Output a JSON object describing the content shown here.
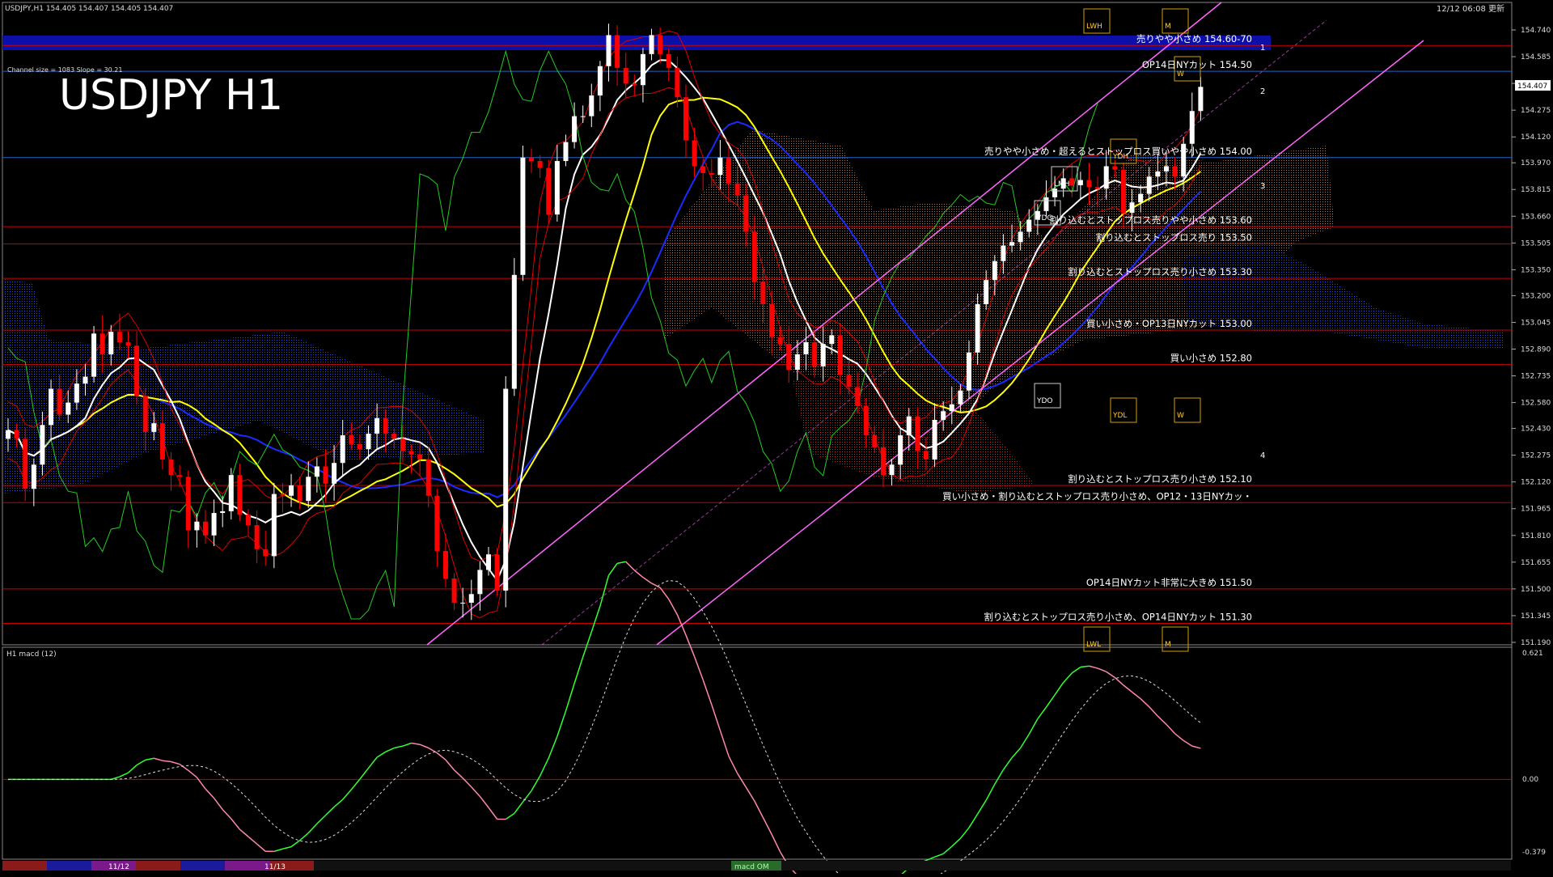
{
  "header": {
    "symbol_info": "USDJPY,H1  154.405 154.407 154.405 154.407",
    "big_title": "USDJPY H1",
    "channel_info": "Channel size = 1083 Slope = 30.21",
    "clock": "12/12 06:08 更新",
    "current_price": "154.407"
  },
  "sub_window": {
    "label": "H1  macd (12)",
    "scale": [
      "0.621",
      "0.00",
      "-0.379"
    ]
  },
  "bottom_bar": {
    "dates": [
      "11/12",
      "11/13"
    ],
    "indicator_label": "macd OM"
  },
  "colors": {
    "up_candle": "#ffffff",
    "down_candle": "#ff0000",
    "ma_white": "#ffffff",
    "ma_yellow": "#ffff00",
    "ma_blue": "#1a2bff",
    "channel": "#ff66ff",
    "macd_up": "#33ff33",
    "macd_down": "#ff88aa",
    "level_line": "#cc0000",
    "band_line": "#0000aa",
    "green_line": "#22cc22"
  },
  "chart_data": {
    "type": "candlestick",
    "title": "USDJPY H1",
    "ylim": [
      151.19,
      154.74
    ],
    "y_ticks": [
      "154.740",
      "154.585",
      "154.430",
      "154.275",
      "154.120",
      "153.970",
      "153.815",
      "153.660",
      "153.505",
      "153.350",
      "153.200",
      "153.045",
      "152.890",
      "152.735",
      "152.580",
      "152.430",
      "152.275",
      "152.120",
      "151.965",
      "151.810",
      "151.655",
      "151.500",
      "151.345",
      "151.190"
    ],
    "levels": [
      {
        "label": "売りやや小さめ 154.60-70",
        "price": 154.65
      },
      {
        "label": "OP14日NYカット 154.50",
        "price": 154.5
      },
      {
        "label": "売りやや小さめ・超えるとストップロス買いやや小さめ 154.00",
        "price": 154.0
      },
      {
        "label": "割り込むとストップロス売りやや小さめ 153.60",
        "price": 153.6
      },
      {
        "label": "割り込むとストップロス売り 153.50",
        "price": 153.5
      },
      {
        "label": "割り込むとストップロス売り小さめ 153.30",
        "price": 153.3
      },
      {
        "label": "買い小さめ・OP13日NYカット 153.00",
        "price": 153.0
      },
      {
        "label": "買い小さめ 152.80",
        "price": 152.8
      },
      {
        "label": "割り込むとストップロス売り小さめ 152.10",
        "price": 152.1
      },
      {
        "label": "買い小さめ・割り込むとストップロス売り小さめ、OP12・13日NYカッ・",
        "price": 152.0
      },
      {
        "label": "OP14日NYカット非常に大きめ 151.50",
        "price": 151.5
      },
      {
        "label": "割り込むとストップロス売り小さめ、OP14日NYカット 151.30",
        "price": 151.3
      }
    ],
    "channel_numbers": [
      "1",
      "2",
      "3",
      "4"
    ],
    "boxes": [
      "LWH",
      "M",
      "W",
      "YDH",
      "LMH",
      "YDC",
      "YDO",
      "YDL",
      "W",
      "LWL",
      "M"
    ],
    "series": [
      {
        "name": "close",
        "values": [
          152.42,
          152.37,
          152.08,
          152.22,
          152.45,
          152.66,
          152.51,
          152.58,
          152.69,
          152.73,
          152.98,
          152.86,
          152.99,
          152.93,
          152.91,
          152.62,
          152.41,
          152.46,
          152.25,
          152.16,
          152.15,
          151.84,
          151.89,
          151.81,
          151.94,
          151.95,
          152.16,
          151.93,
          151.87,
          151.73,
          151.69,
          152.05,
          152.04,
          152.1,
          152.01,
          152.15,
          152.21,
          152.11,
          152.23,
          152.39,
          152.34,
          152.31,
          152.4,
          152.49,
          152.4,
          152.37,
          152.3,
          152.28,
          152.25,
          152.04,
          151.72,
          151.56,
          151.42,
          151.42,
          151.47,
          151.61,
          151.7,
          151.49,
          152.66,
          153.32,
          154.0,
          153.98,
          153.94,
          153.67,
          153.98,
          154.09,
          154.24,
          154.24,
          154.36,
          154.53,
          154.71,
          154.52,
          154.43,
          154.42,
          154.6,
          154.71,
          154.6,
          154.52,
          154.35,
          154.1,
          153.95,
          153.91,
          153.9,
          154.0,
          153.85,
          153.78,
          153.57,
          153.28,
          153.15,
          152.96,
          152.92,
          152.77,
          152.86,
          152.93,
          152.79,
          152.92,
          152.97,
          152.74,
          152.67,
          152.56,
          152.39,
          152.32,
          152.16,
          152.22,
          152.39,
          152.5,
          152.3,
          152.25,
          152.48,
          152.53,
          152.57,
          152.65,
          152.87,
          153.15,
          153.29,
          153.4,
          153.49,
          153.51,
          153.57,
          153.64,
          153.69,
          153.77,
          153.82,
          153.88,
          153.84,
          153.87,
          153.83,
          153.82,
          153.95,
          153.93,
          153.68,
          153.74,
          153.79,
          153.89,
          153.92,
          153.95,
          153.89,
          154.08,
          154.27,
          154.41
        ]
      }
    ]
  }
}
